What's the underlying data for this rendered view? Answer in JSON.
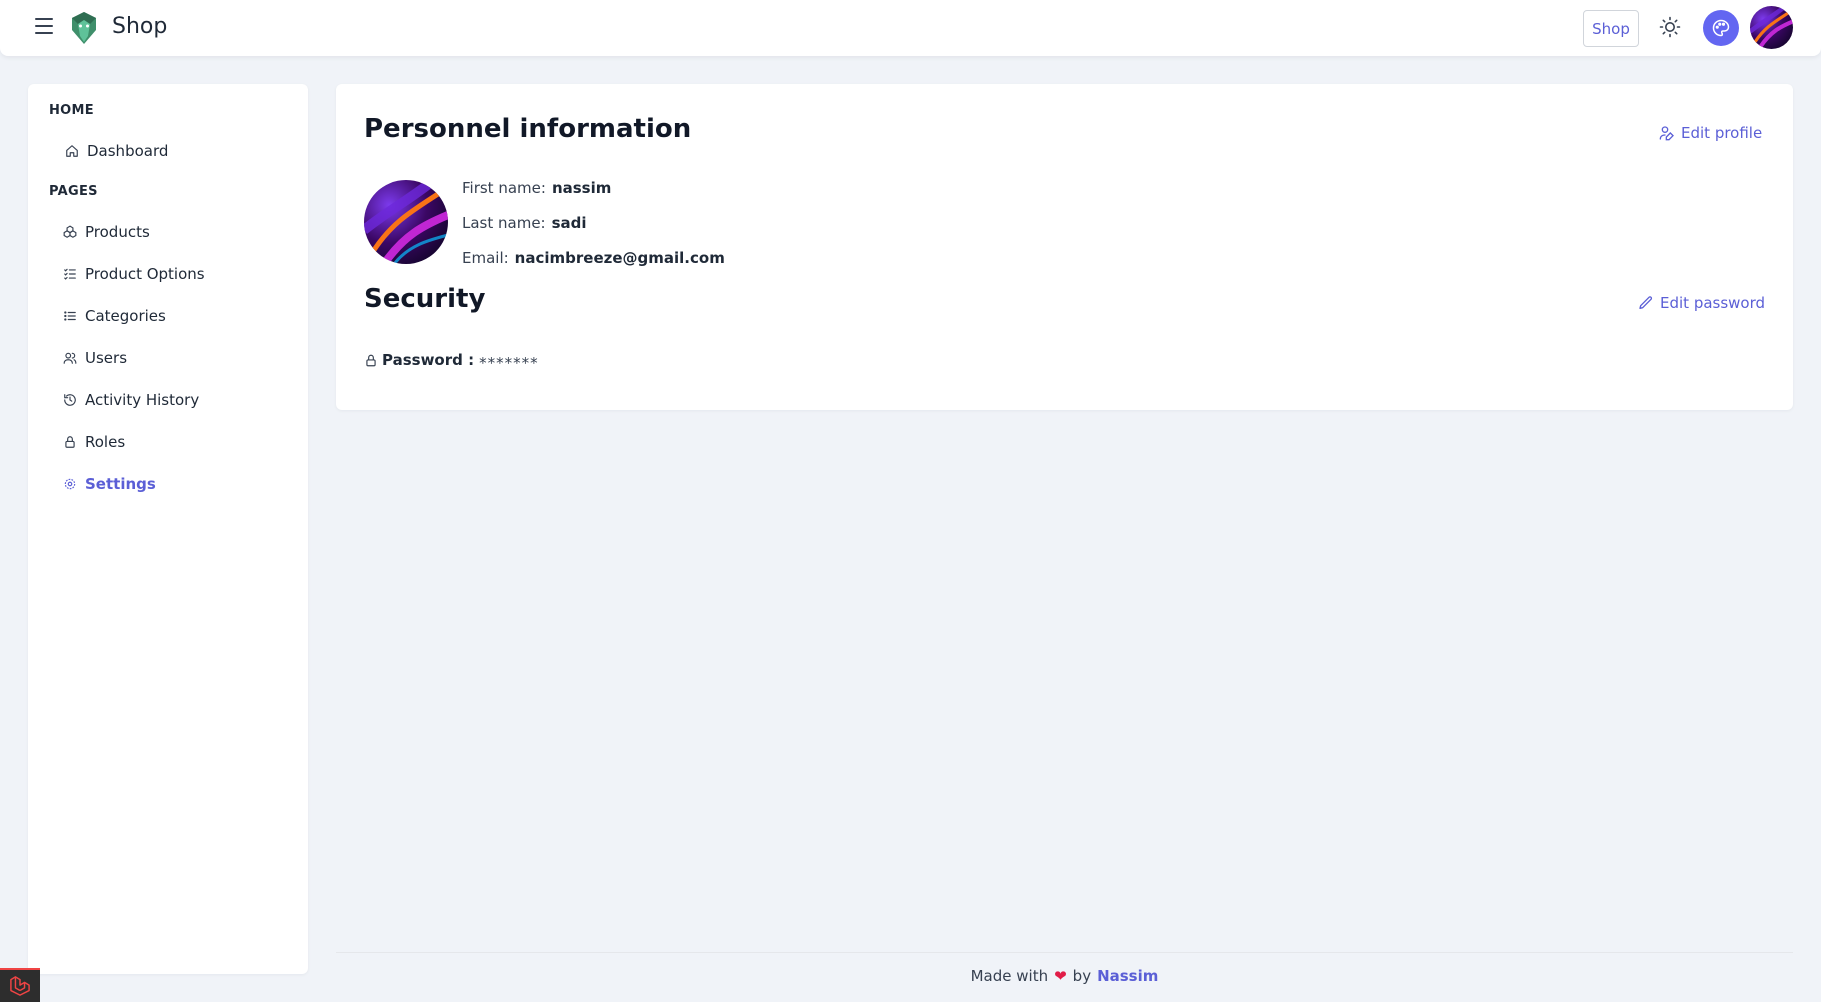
{
  "header": {
    "app_title": "Shop",
    "shop_button_label": "Shop",
    "accent_color": "#6366f1"
  },
  "sidebar": {
    "sections": [
      {
        "heading": "HOME",
        "items": [
          {
            "label": "Dashboard",
            "icon": "home-icon"
          }
        ]
      },
      {
        "heading": "PAGES",
        "items": [
          {
            "label": "Products",
            "icon": "cubes-icon"
          },
          {
            "label": "Product Options",
            "icon": "list-check-icon"
          },
          {
            "label": "Categories",
            "icon": "list-icon"
          },
          {
            "label": "Users",
            "icon": "users-icon"
          },
          {
            "label": "Activity History",
            "icon": "history-icon"
          },
          {
            "label": "Roles",
            "icon": "lock-icon"
          },
          {
            "label": "Settings",
            "icon": "gear-icon",
            "active": true
          }
        ]
      }
    ]
  },
  "profile": {
    "title": "Personnel information",
    "edit_profile_label": "Edit profile",
    "first_name_label": "First name:",
    "first_name": "nassim",
    "last_name_label": "Last name:",
    "last_name": "sadi",
    "email_label": "Email:",
    "email": "nacimbreeze@gmail.com"
  },
  "security": {
    "title": "Security",
    "edit_password_label": "Edit password",
    "password_label": "Password :",
    "password_value": "*******"
  },
  "footer": {
    "made_with": "Made with",
    "heart": "❤",
    "by": "by",
    "author": "Nassim"
  }
}
